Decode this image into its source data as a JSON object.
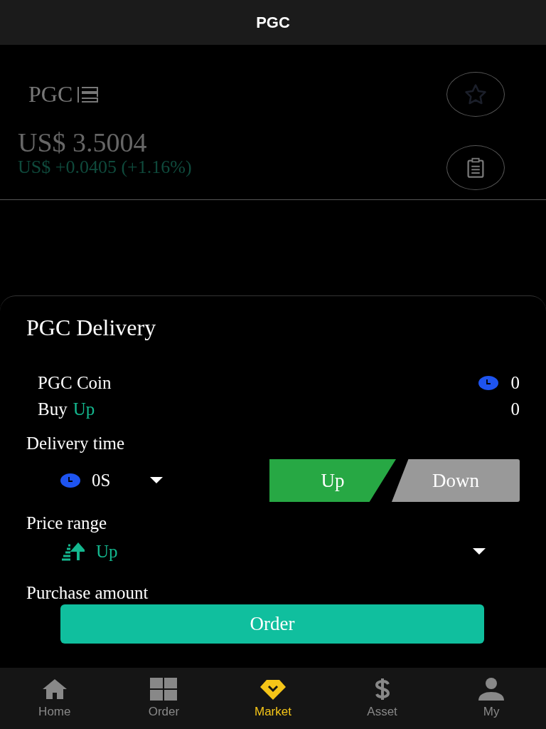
{
  "header": {
    "title": "PGC"
  },
  "market": {
    "symbol": "PGC",
    "price": "US$ 3.5004",
    "change": "US$ +0.0405 (+1.16%)"
  },
  "sheet": {
    "title": "PGC Delivery",
    "coin_label": "PGC Coin",
    "coin_value": "0",
    "buy_label": "Buy",
    "buy_direction": "Up",
    "buy_value": "0",
    "delivery_time_label": "Delivery time",
    "delivery_time": "0S",
    "directions": [
      {
        "label": "Up",
        "selected": true
      },
      {
        "label": "Down",
        "selected": false
      }
    ],
    "price_range_label": "Price range",
    "price_range": "Up",
    "purchase_amount_label": "Purchase amount",
    "order_button": "Order"
  },
  "nav": [
    {
      "label": "Home",
      "selected": false
    },
    {
      "label": "Order",
      "selected": false
    },
    {
      "label": "Market",
      "selected": true
    },
    {
      "label": "Asset",
      "selected": false
    },
    {
      "label": "My",
      "selected": false
    }
  ]
}
